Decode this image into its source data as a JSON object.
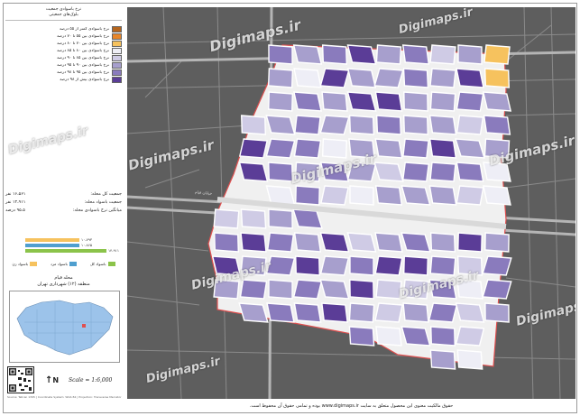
{
  "legend": {
    "title_line1": "نرخ باسوادی جمعیت",
    "title_line2": "بلوک‌های جمعیتی",
    "items": [
      {
        "label": "نرخ باسوادی کمتر از ۵۵ درصد",
        "color": "#b5651d"
      },
      {
        "label": "نرخ باسوادی بین ۵۵ تا ۷۰ درصد",
        "color": "#e8862a"
      },
      {
        "label": "نرخ باسوادی بین ۷۰ تا ۸۰ درصد",
        "color": "#f6c25e"
      },
      {
        "label": "نرخ باسوادی بین ۸۰ تا ۸۵ درصد",
        "color": "#eeeef6"
      },
      {
        "label": "نرخ باسوادی بین ۸۵ تا ۹۰ درصد",
        "color": "#cfcbe5"
      },
      {
        "label": "نرخ باسوادی بین ۹۰ تا ۹۵ درصد",
        "color": "#a79fcd"
      },
      {
        "label": "نرخ باسوادی بین ۹۵ تا ۹۸ درصد",
        "color": "#8a7bbd"
      },
      {
        "label": "نرخ باسوادی بیش از ۹۸ درصد",
        "color": "#5b3d97"
      }
    ]
  },
  "stats": [
    {
      "label": "جمعیت کل محله:",
      "value": "۱۶،۵۶۱ نفر"
    },
    {
      "label": "جمعیت باسواد محله:",
      "value": "۱۴،۹۱۱ نفر"
    },
    {
      "label": "میانگین نرخ باسوادی محله:",
      "value": "۹۵.۵ درصد"
    }
  ],
  "bars": [
    {
      "label": "۱۰،۷۹۳",
      "color": "#f6c25e",
      "fraction": 0.6
    },
    {
      "label": "۱۰،۸۶۵",
      "color": "#4f9fcf",
      "fraction": 0.6
    },
    {
      "label": "۱۴،۹۱۱",
      "color": "#8bc34a",
      "fraction": 0.9
    }
  ],
  "landuse": [
    {
      "label": "باسواد زن",
      "color": "#f6c25e"
    },
    {
      "label": "باسواد مرد",
      "color": "#4f9fcf"
    },
    {
      "label": "باسواد کل",
      "color": "#8bc34a"
    }
  ],
  "location": {
    "line1": "محله قیام",
    "line2": "منطقه (۱۲) شهرداری تهران"
  },
  "scale": "Scale = 1:6,000",
  "north_label": "N",
  "credits": "Source: Tehran 1395 | Coordinate System: WGS 84 | Projection: Transverse Mercator",
  "watermark": "Digimaps.ir",
  "footer": "حقوق مالکیت معنوی این محصول متعلق به سایت www.digimaps.ir بوده و تمامی حقوق آن محفوظ است.",
  "colors": {
    "boundary": "#e05050",
    "basemap": "#5e5e5e",
    "road": "#ffffff"
  }
}
